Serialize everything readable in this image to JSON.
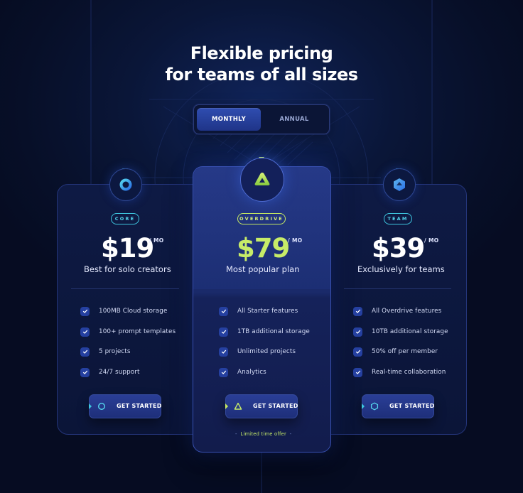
{
  "heading": {
    "line1": "Flexible pricing",
    "line2": "for teams of all sizes"
  },
  "billing_toggle": {
    "options": [
      "MONTHLY",
      "ANNUAL"
    ],
    "selected": "MONTHLY"
  },
  "plans": [
    {
      "badge": "CORE",
      "price": "$19",
      "period": "/ MO",
      "tagline": "Best for solo creators",
      "icon": "ring-icon",
      "accent": "#3ec7e0",
      "features": [
        "100MB Cloud storage",
        "100+ prompt templates",
        "5 projects",
        "24/7 support"
      ],
      "cta": "GET STARTED"
    },
    {
      "badge": "OVERDRIVE",
      "price": "$79",
      "period": "/ MO",
      "tagline": "Most popular plan",
      "icon": "triangle-icon",
      "accent": "#c6ea62",
      "featured": true,
      "features": [
        "All Starter features",
        "1TB additional storage",
        "Unlimited projects",
        "Analytics"
      ],
      "cta": "GET STARTED",
      "footnote": "Limited time offer"
    },
    {
      "badge": "TEAM",
      "price": "$39",
      "period": "/ MO",
      "tagline": "Exclusively for teams",
      "icon": "hexagon-icon",
      "accent": "#3ec7e0",
      "features": [
        "All Overdrive features",
        "10TB additional storage",
        "50% off per member",
        "Real-time collaboration"
      ],
      "cta": "GET STARTED"
    }
  ],
  "colors": {
    "background": "#070f28",
    "card": "#0e1a44",
    "featured_card": "#1e2e72",
    "lime": "#c7ec68",
    "cyan": "#3ec7e0"
  }
}
